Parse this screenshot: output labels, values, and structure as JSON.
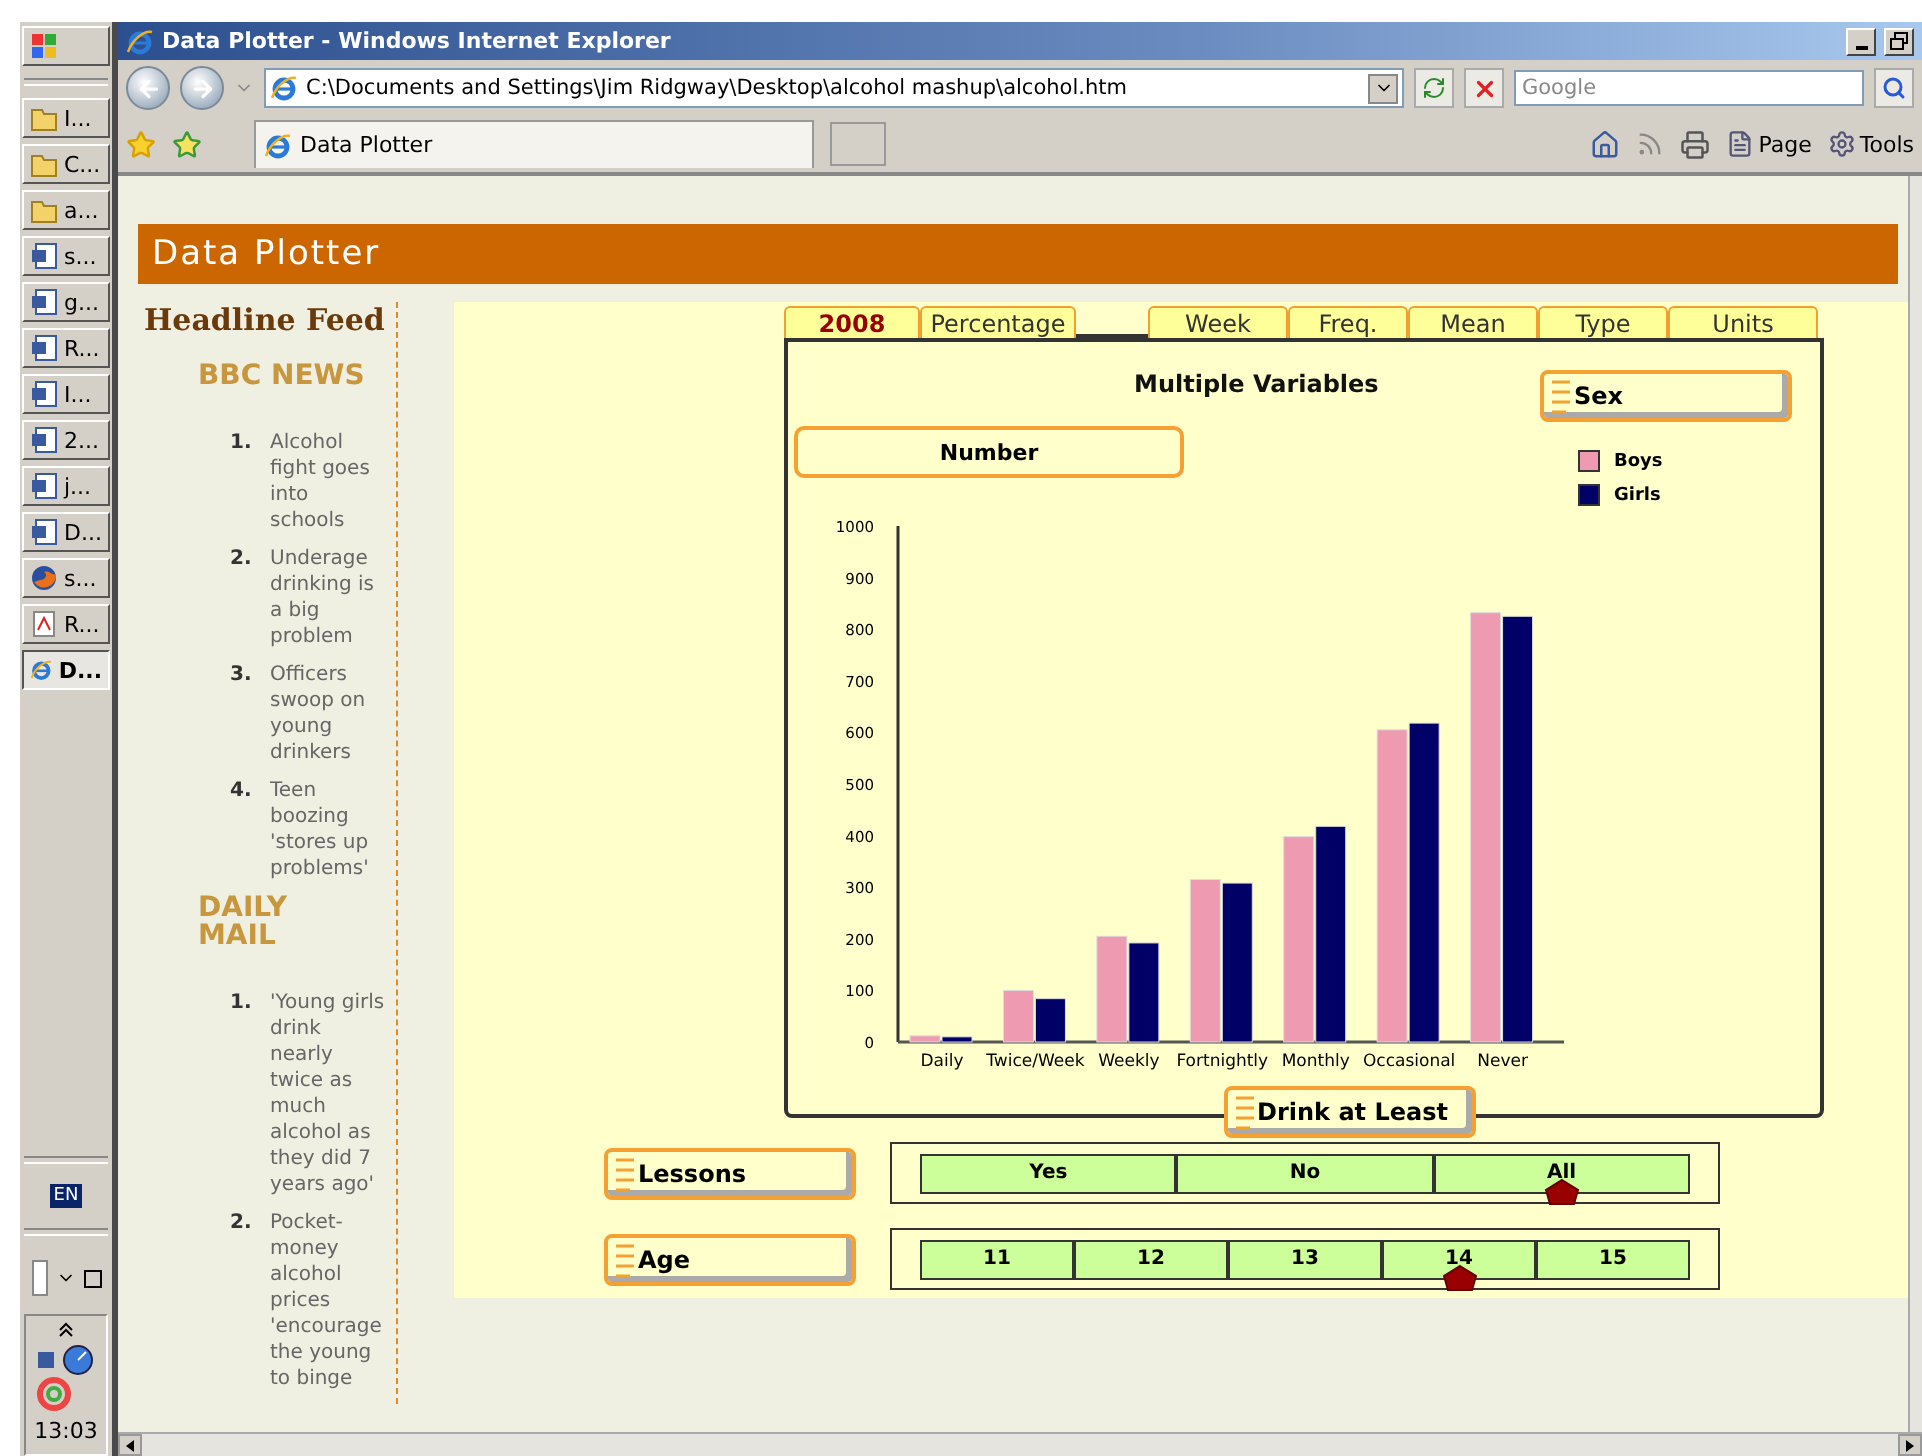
{
  "taskbar": {
    "items": [
      {
        "label": "I...",
        "kind": "folder",
        "selected": false
      },
      {
        "label": "C...",
        "kind": "folder",
        "selected": false
      },
      {
        "label": "a...",
        "kind": "folder",
        "selected": false
      },
      {
        "label": "s...",
        "kind": "word",
        "selected": false
      },
      {
        "label": "g...",
        "kind": "word",
        "selected": false
      },
      {
        "label": "R...",
        "kind": "word",
        "selected": false
      },
      {
        "label": "I...",
        "kind": "word",
        "selected": false
      },
      {
        "label": "2...",
        "kind": "word",
        "selected": false
      },
      {
        "label": "j...",
        "kind": "word",
        "selected": false
      },
      {
        "label": "D...",
        "kind": "word",
        "selected": false
      },
      {
        "label": "s...",
        "kind": "firefox",
        "selected": false
      },
      {
        "label": "R...",
        "kind": "pdf",
        "selected": false
      },
      {
        "label": "D...",
        "kind": "ie",
        "selected": true
      }
    ],
    "language": "EN",
    "clock": "13:03"
  },
  "browser": {
    "title": "Data Plotter - Windows Internet Explorer",
    "address": "C:\\Documents and Settings\\Jim Ridgway\\Desktop\\alcohol mashup\\alcohol.htm",
    "search_placeholder": "Google",
    "tab": "Data Plotter",
    "toolbar": [
      "Page",
      "Tools"
    ]
  },
  "page": {
    "header": "Data Plotter",
    "feed": {
      "title": "Headline Feed",
      "sources": [
        {
          "name": "BBC NEWS",
          "items": [
            {
              "number": "1.",
              "text": "Alcohol fight goes into schools"
            },
            {
              "number": "2.",
              "text": "Underage drinking is a big problem"
            },
            {
              "number": "3.",
              "text": "Officers swoop on young drinkers"
            },
            {
              "number": "4.",
              "text": "Teen boozing 'stores up problems'"
            }
          ]
        },
        {
          "name": "DAILY MAIL",
          "items": [
            {
              "number": "1.",
              "text": "'Young girls drink nearly twice as much alcohol as they did 7 years ago'"
            },
            {
              "number": "2.",
              "text": "Pocket-money alcohol prices 'encourage the young to binge"
            }
          ]
        }
      ]
    }
  },
  "plotter": {
    "tabs": [
      {
        "label": "2008",
        "selected": true
      },
      {
        "label": "Percentage",
        "selected": false
      },
      {
        "label": "Week",
        "selected": false
      },
      {
        "label": "Freq.",
        "selected": false
      },
      {
        "label": "Mean",
        "selected": false
      },
      {
        "label": "Type",
        "selected": false
      },
      {
        "label": "Units",
        "selected": false
      }
    ],
    "legend_button": "Sex",
    "chart_data": {
      "type": "bar",
      "title": "Multiple Variables",
      "xlabel": "Drink at Least",
      "ylabel": "Number",
      "categories": [
        "Daily",
        "Twice/Week",
        "Weekly",
        "Fortnightly",
        "Monthly",
        "Occasional",
        "Never"
      ],
      "series": [
        {
          "name": "Boys",
          "color": "#ee9ab0",
          "values": [
            12,
            100,
            205,
            315,
            398,
            605,
            832
          ]
        },
        {
          "name": "Girls",
          "color": "#000066",
          "values": [
            10,
            84,
            192,
            308,
            418,
            618,
            825
          ]
        }
      ],
      "legend": "right",
      "ylim": [
        0,
        1000
      ],
      "yticks": [
        0,
        100,
        200,
        300,
        400,
        500,
        600,
        700,
        800,
        900,
        1000
      ]
    },
    "filters": [
      {
        "label": "Lessons",
        "options": [
          {
            "label": "Yes",
            "selected": false
          },
          {
            "label": "No",
            "selected": false
          },
          {
            "label": "All",
            "selected": true
          }
        ]
      },
      {
        "label": "Age",
        "options": [
          {
            "label": "11",
            "selected": false
          },
          {
            "label": "12",
            "selected": false
          },
          {
            "label": "13",
            "selected": false
          },
          {
            "label": "14",
            "selected": true
          },
          {
            "label": "15",
            "selected": false
          }
        ]
      }
    ]
  }
}
